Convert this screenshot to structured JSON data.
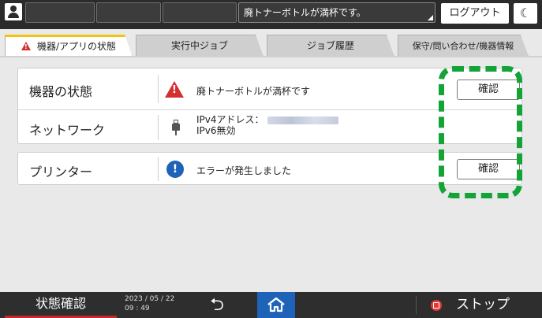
{
  "topbar": {
    "message": "廃トナーボトルが満杯です。",
    "logout_label": "ログアウト",
    "moon_glyph": "☾"
  },
  "tabs": [
    {
      "label": "機器/アプリの状態",
      "active": true
    },
    {
      "label": "実行中ジョブ",
      "active": false
    },
    {
      "label": "ジョブ履歴",
      "active": false
    },
    {
      "label": "保守/問い合わせ/機器情報",
      "active": false
    }
  ],
  "status": {
    "device_label": "機器の状態",
    "device_message": "廃トナーボトルが満杯です",
    "device_button": "確認",
    "network_label": "ネットワーク",
    "network_ipv4": "IPv4アドレス：",
    "network_ipv6": "IPv6無効",
    "printer_label": "プリンター",
    "printer_message": "エラーが発生しました",
    "printer_button": "確認"
  },
  "bottombar": {
    "status_label": "状態確認",
    "date": "2023 / 05 / 22",
    "time": "09 : 49",
    "back_glyph": "⮌",
    "stop_label": "ストップ"
  },
  "colors": {
    "highlight": "#13a337",
    "alert": "#d32f2f",
    "info": "#1e63b8",
    "tab_accent": "#f1c40f"
  }
}
